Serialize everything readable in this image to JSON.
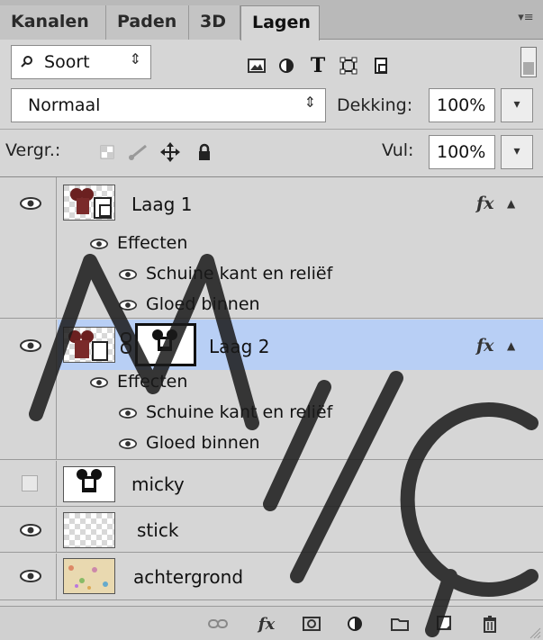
{
  "tabs": [
    {
      "label": "Kanalen",
      "active": false
    },
    {
      "label": "Paden",
      "active": false
    },
    {
      "label": "3D",
      "active": false
    },
    {
      "label": "Lagen",
      "active": true
    }
  ],
  "filter": {
    "label": "Soort",
    "search_icon": "search-icon"
  },
  "filter_icons": [
    "image-filter-icon",
    "adjustment-filter-icon",
    "type-filter-icon",
    "shape-filter-icon",
    "smart-object-filter-icon"
  ],
  "blend": {
    "mode": "Normaal",
    "opacity_label": "Dekking:",
    "opacity_value": "100%"
  },
  "lock": {
    "label": "Vergr.:",
    "fill_label": "Vul:",
    "fill_value": "100%"
  },
  "layers": [
    {
      "name": "Laag 1",
      "visible": true,
      "fx": "fx",
      "effects_label": "Effecten",
      "effects": [
        "Schuine kant en reliëf",
        "Gloed binnen"
      ]
    },
    {
      "name": "Laag 2",
      "visible": true,
      "fx": "fx",
      "selected": true,
      "effects_label": "Effecten",
      "effects": [
        "Schuine kant en reliëf",
        "Gloed binnen"
      ]
    },
    {
      "name": "micky",
      "visible": false
    },
    {
      "name": "stick",
      "visible": true
    },
    {
      "name": "achtergrond",
      "visible": true
    }
  ],
  "bottom_icons": [
    "link-icon",
    "fx-icon",
    "mask-icon",
    "adjustment-icon",
    "folder-icon",
    "new-layer-icon",
    "trash-icon"
  ],
  "bottom_fx_label": "fx",
  "colors": {
    "selection": "#b8cff5",
    "panel": "#d6d6d6",
    "tabbar": "#b9b9b9",
    "watermark": "#1a1a1a"
  }
}
